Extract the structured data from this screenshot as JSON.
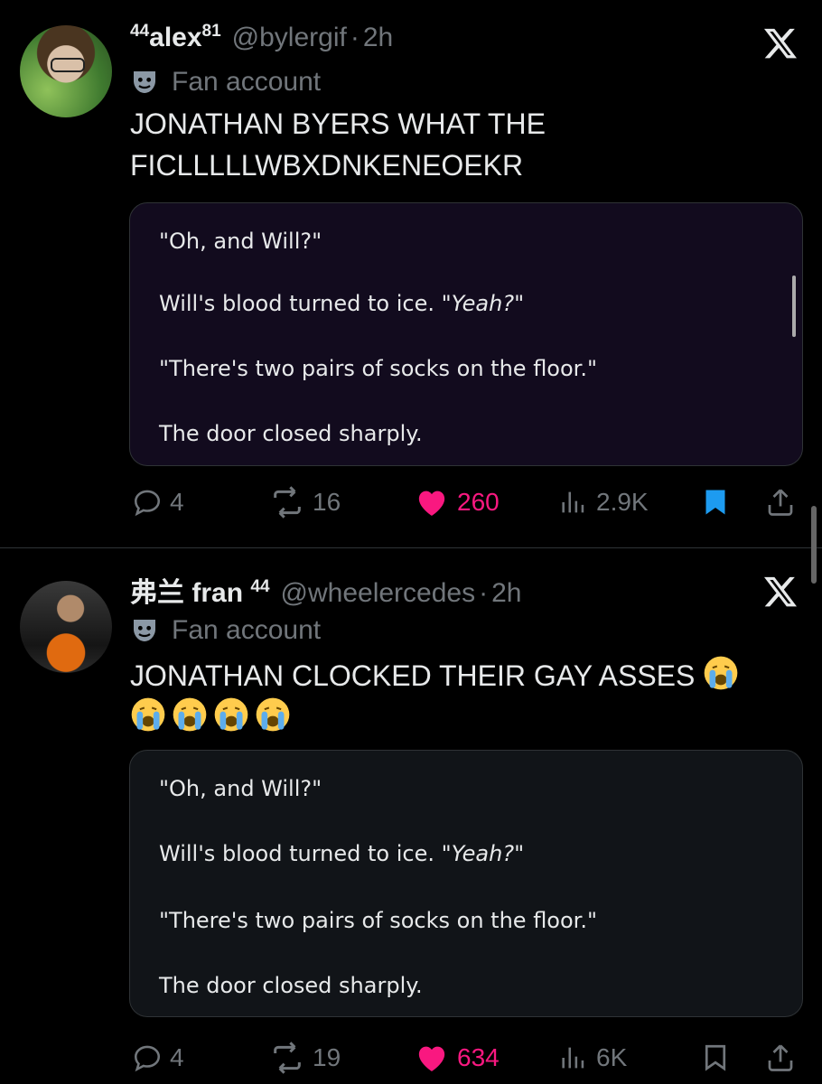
{
  "colors": {
    "background": "#000000",
    "text": "#e7e9ea",
    "muted": "#71767b",
    "like": "#f91880",
    "bookmark": "#1d9bf0",
    "card1_bg": "#120b1e",
    "card2_bg": "#111418"
  },
  "tweets": [
    {
      "name_prefix": "44",
      "name": "alex",
      "name_suffix": "81",
      "handle": "@bylergif",
      "separator": "·",
      "time": "2h",
      "label": "Fan account",
      "text": "JONATHAN BYERS WHAT THE FICLLLLLWBXDNKENEOEKR",
      "card": {
        "line1": "\"Oh, and Will?\"",
        "line2_plain": "Will's blood turned to ice. ",
        "line2_italic": "\"Yeah?\"",
        "line3": "\"There's two pairs of socks on the floor.\"",
        "line4": "The door closed sharply."
      },
      "replies": "4",
      "reposts": "16",
      "likes": "260",
      "views": "2.9K",
      "liked": true,
      "bookmarked": true
    },
    {
      "name_prefix": "弗兰",
      "name": "fran",
      "name_suffix": "44",
      "handle": "@wheelercedes",
      "separator": "·",
      "time": "2h",
      "label": "Fan account",
      "text": "JONATHAN CLOCKED THEIR GAY ASSES",
      "emoji_count": 5,
      "card": {
        "line1": "\"Oh, and Will?\"",
        "line2_plain": "Will's blood turned to ice. ",
        "line2_italic": "\"Yeah?\"",
        "line3": "\"There's two pairs of socks on the floor.\"",
        "line4": "The door closed sharply."
      },
      "replies": "4",
      "reposts": "19",
      "likes": "634",
      "views": "6K",
      "liked": true,
      "bookmarked": false
    }
  ]
}
